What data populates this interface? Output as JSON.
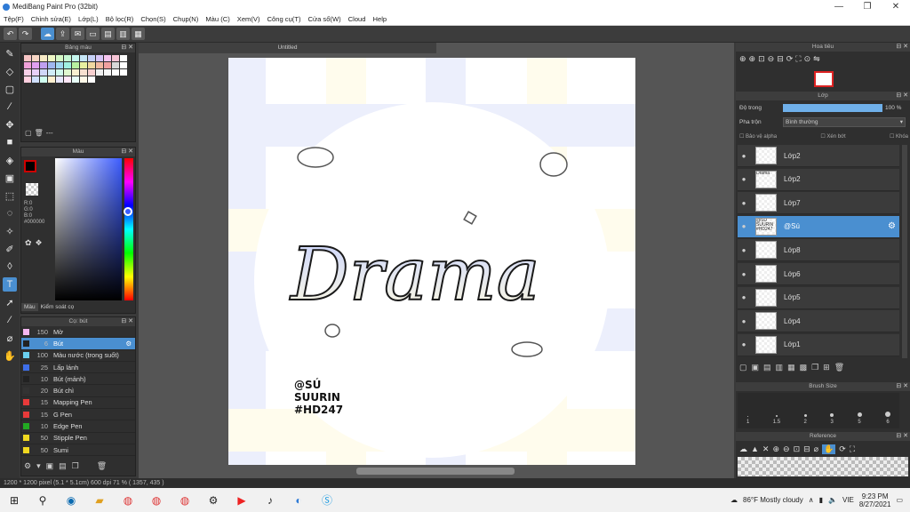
{
  "window": {
    "title": "MediBang Paint Pro (32bit)"
  },
  "menu": [
    "Tệp(F)",
    "Chỉnh sửa(E)",
    "Lớp(L)",
    "Bộ lọc(R)",
    "Chọn(S)",
    "Chụp(N)",
    "Màu (C)",
    "Xem(V)",
    "Công cụ(T)",
    "Cửa sổ(W)",
    "Cloud",
    "Help"
  ],
  "panels": {
    "palette": "Bảng màu",
    "palette_value": "---",
    "color": "Màu",
    "color_tabs": [
      "Màu",
      "Kiểm soát cọ"
    ],
    "rgb": [
      "R:0",
      "G:0",
      "B:0"
    ],
    "hex": "#000000",
    "brush": "Cọ: bút",
    "navigator": "Hoa tiêu",
    "layer": "Lớp",
    "brushsize": "Brush Size",
    "reference": "Reference"
  },
  "brushes": [
    {
      "size": "150",
      "name": "Mờ",
      "color": "#f4b6f0"
    },
    {
      "size": "6",
      "name": "Bút",
      "color": "#222222",
      "selected": true
    },
    {
      "size": "100",
      "name": "Màu nước (trong suốt)",
      "color": "#6ad0f0"
    },
    {
      "size": "25",
      "name": "Lấp lánh",
      "color": "#3e6ee8"
    },
    {
      "size": "10",
      "name": "Bút (mảnh)",
      "color": "#222222"
    },
    {
      "size": "20",
      "name": "Bút chì",
      "color": "#333333"
    },
    {
      "size": "15",
      "name": "Mapping Pen",
      "color": "#e83a3a"
    },
    {
      "size": "15",
      "name": "G Pen",
      "color": "#e83a3a"
    },
    {
      "size": "10",
      "name": "Edge Pen",
      "color": "#22aa22"
    },
    {
      "size": "50",
      "name": "Stipple Pen",
      "color": "#f0d820"
    },
    {
      "size": "50",
      "name": "Sumi",
      "color": "#f0d820"
    }
  ],
  "document": {
    "tab": "Untitled"
  },
  "canvas_text": {
    "main": "Drama",
    "credit": [
      "@SÚ",
      "SUURIN",
      "#HD247"
    ]
  },
  "layer_panel": {
    "opacity_label": "Độ trong",
    "opacity_value": "100 %",
    "blend_label": "Pha trộn",
    "blend_value": "Bình thường",
    "options": [
      "Bảo vệ alpha",
      "Xén bớt",
      "Khóa"
    ]
  },
  "layers": [
    {
      "name": "Lớp2",
      "thumb": ""
    },
    {
      "name": "Lớp2",
      "thumb": "Drama"
    },
    {
      "name": "Lớp7",
      "thumb": ""
    },
    {
      "name": "@Sú",
      "thumb": "@SÚ SUURIN #HD247",
      "selected": true
    },
    {
      "name": "Lớp8",
      "thumb": ""
    },
    {
      "name": "Lớp6",
      "thumb": ""
    },
    {
      "name": "Lớp5",
      "thumb": ""
    },
    {
      "name": "Lớp4",
      "thumb": ""
    },
    {
      "name": "Lớp1",
      "thumb": ""
    }
  ],
  "brush_sizes": [
    "1",
    "1.5",
    "2",
    "3",
    "5",
    "6"
  ],
  "status": "1200 * 1200 pixel   (5.1 * 5.1cm)   600 dpi   71 %   ( 1357, 435 )",
  "taskbar": {
    "weather": "86°F  Mostly cloudy",
    "lang": "VIE",
    "time": "9:23 PM",
    "date": "8/27/2021"
  }
}
